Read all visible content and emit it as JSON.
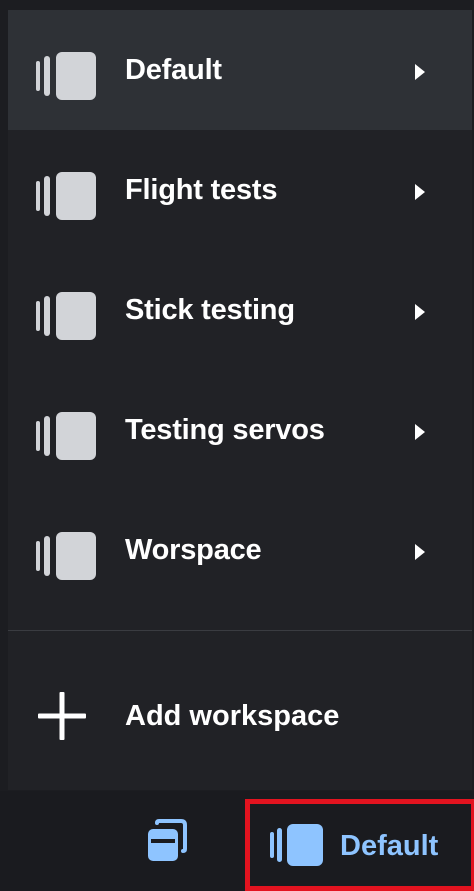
{
  "workspace_menu": {
    "items": [
      {
        "label": "Default",
        "active": true
      },
      {
        "label": "Flight tests",
        "active": false
      },
      {
        "label": "Stick testing",
        "active": false
      },
      {
        "label": "Testing servos",
        "active": false
      },
      {
        "label": "Worspace",
        "active": false
      }
    ],
    "add_label": "Add workspace",
    "icons": {
      "workspace": "workspace-icon",
      "chevron": "chevron-right-icon",
      "add": "plus-icon"
    }
  },
  "footer": {
    "windows_icon": "windows-icon",
    "current_workspace_label": "Default",
    "current_workspace_icon": "workspace-icon",
    "highlight_color": "#e3131f",
    "accent_color": "#8ec4ff"
  }
}
